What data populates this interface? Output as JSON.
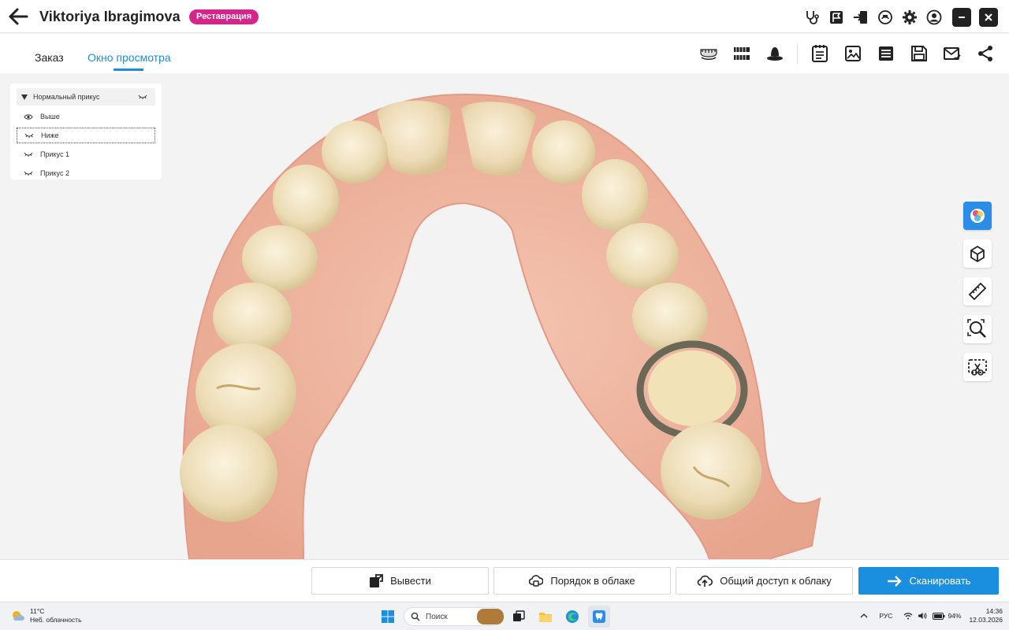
{
  "header": {
    "patient_name": "Viktoriya Ibragimova",
    "badge": "Реставрация",
    "icons": [
      "stethoscope-icon",
      "flag-icon",
      "import-icon",
      "cloud-scan-icon",
      "gear-icon",
      "user-icon",
      "minimize-icon",
      "close-icon"
    ]
  },
  "tabs": [
    {
      "label": "Заказ",
      "active": false
    },
    {
      "label": "Окно просмотра",
      "active": true
    }
  ],
  "toolbar_icons": [
    "upper-jaw-icon",
    "jaw-arch-icon",
    "tooth-crown-icon",
    "order-notes-icon",
    "images-icon",
    "report-icon",
    "save-icon",
    "mail-icon",
    "share-icon"
  ],
  "layers": {
    "group": "Нормальный прикус",
    "items": [
      {
        "label": "Выше",
        "icon": "eye-icon",
        "selected": false
      },
      {
        "label": "Ниже",
        "icon": "hidden-eye-icon",
        "selected": true
      },
      {
        "label": "Прикус 1",
        "icon": "hidden-eye-icon",
        "selected": false
      },
      {
        "label": "Прикус 2",
        "icon": "hidden-eye-icon",
        "selected": false
      }
    ]
  },
  "right_tools": [
    "color-texture-icon",
    "3d-cube-icon",
    "ruler-icon",
    "zoom-focus-icon",
    "crop-select-icon"
  ],
  "bottom_actions": {
    "export": "Вывести",
    "cloud_order": "Порядок в облаке",
    "cloud_share": "Общий доступ к облаку",
    "scan": "Сканировать"
  },
  "taskbar": {
    "temp": "11°C",
    "weather": "Неб. облачность",
    "search_placeholder": "Поиск",
    "lang": "РУС",
    "battery": "94%",
    "time": "14:36",
    "date": "12.03.2026"
  },
  "colors": {
    "accent": "#1a8fe0",
    "badge": "#d6248b"
  }
}
